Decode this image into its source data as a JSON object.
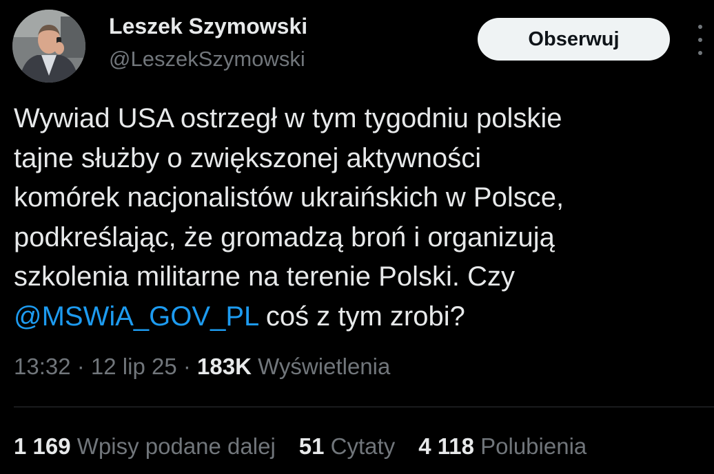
{
  "author": {
    "name": "Leszek Szymowski",
    "handle": "@LeszekSzymowski"
  },
  "follow_label": "Obserwuj",
  "tweet": {
    "line1": "Wywiad USA ostrzegł w tym tygodniu polskie",
    "line2": "tajne służby o zwiększonej aktywności",
    "line3": "komórek nacjonalistów ukraińskich w Polsce,",
    "line4": "podkreślając, że gromadzą broń i organizują",
    "line5": "szkolenia militarne na terenie Polski. Czy",
    "mention": "@MSWiA_GOV_PL",
    "line6_rest": " coś z tym zrobi?"
  },
  "meta": {
    "time": "13:32",
    "sep1": " · ",
    "date": "12 lip 25",
    "sep2": " · ",
    "views_count": "183K",
    "views_label": " Wyświetlenia"
  },
  "stats": {
    "reposts_count": "1 169",
    "reposts_label": " Wpisy podane dalej",
    "quotes_count": "51",
    "quotes_label": " Cytaty",
    "likes_count": "4 118",
    "likes_label": " Polubienia"
  },
  "colors": {
    "background": "#000000",
    "text": "#e7e9ea",
    "secondary": "#71767b",
    "link": "#1d9bf0",
    "button_bg": "#eff3f4"
  },
  "icons": {
    "more": "more-vertical-icon"
  }
}
